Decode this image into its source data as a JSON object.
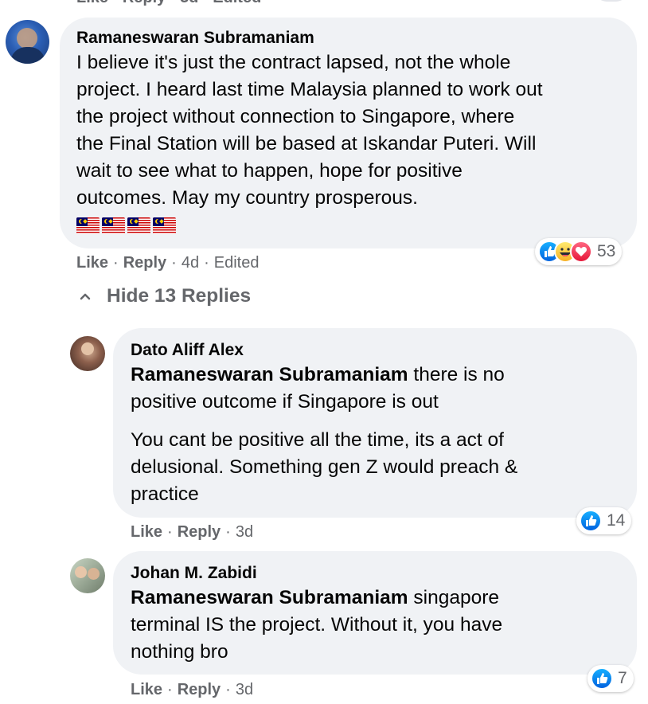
{
  "top_fragment": {
    "like": "Like",
    "reply": "Reply",
    "age": "3d",
    "edited": "Edited"
  },
  "comment": {
    "author": "Ramaneswaran Subramaniam",
    "text": "I believe it's just the contract lapsed, not the whole\nproject. I heard last time Malaysia planned to work out\nthe project without connection to Singapore, where\nthe Final Station will be based at Iskandar Puteri. Will\nwait to see what to happen, hope for positive\noutcomes. May my country prosperous.",
    "flags": [
      "malaysia-flag-icon",
      "malaysia-flag-icon",
      "malaysia-flag-icon",
      "malaysia-flag-icon"
    ],
    "like": "Like",
    "reply": "Reply",
    "age": "4d",
    "edited": "Edited",
    "reactions": {
      "types": [
        "like",
        "haha",
        "love"
      ],
      "count": "53"
    }
  },
  "hide_replies": {
    "label": "Hide 13 Replies"
  },
  "replies": [
    {
      "author": "Dato Aliff Alex",
      "mention": "Ramaneswaran Subramaniam",
      "text_part1": " there is no\npositive outcome if Singapore is out",
      "text_part2": "You cant be positive all the time, its a act of\ndelusional. Something gen Z would preach &\npractice",
      "like": "Like",
      "reply": "Reply",
      "age": "3d",
      "reactions": {
        "types": [
          "like"
        ],
        "count": "14"
      }
    },
    {
      "author": "Johan M. Zabidi",
      "mention": "Ramaneswaran Subramaniam",
      "text_part1": " singapore\nterminal IS the project. Without it, you have\nnothing bro",
      "like": "Like",
      "reply": "Reply",
      "age": "3d",
      "reactions": {
        "types": [
          "like"
        ],
        "count": "7"
      }
    }
  ],
  "colors": {
    "bubble": "#f0f2f5",
    "meta_text": "#65676b",
    "like_blue": "#1877f2"
  }
}
